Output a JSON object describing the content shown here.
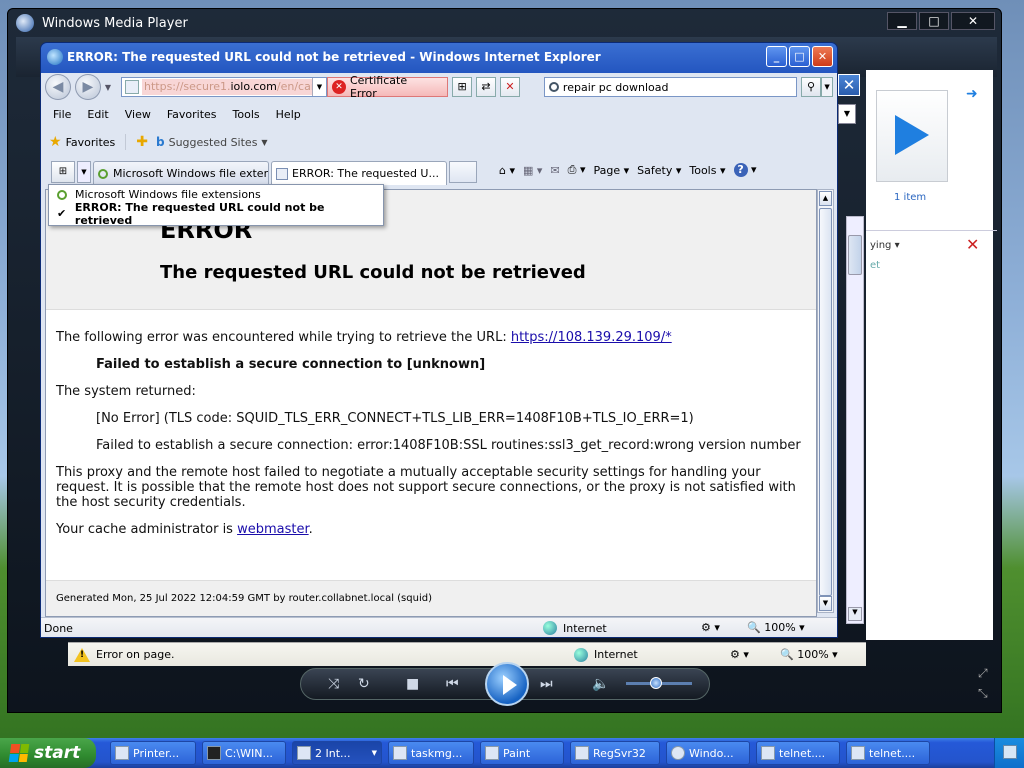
{
  "wmp": {
    "title": "Windows Media Player",
    "min": "▁",
    "max": "□",
    "close": "✕",
    "library_item_count": "1 item",
    "partial_label_1": "ying",
    "partial_label_2": "et",
    "statusbar": {
      "message": "Error on page.",
      "zone": "Internet",
      "zoom": "100%"
    }
  },
  "ie": {
    "title": "ERROR: The requested URL could not be retrieved - Windows Internet Explorer",
    "address_prefix": "https://secure1.",
    "address_domain": "iolo.com",
    "address_suffix": "/en/cart/",
    "cert_error": "Certificate Error",
    "search_value": "repair pc download",
    "menu": [
      "File",
      "Edit",
      "View",
      "Favorites",
      "Tools",
      "Help"
    ],
    "favorites_label": "Favorites",
    "suggested_sites": "Suggested Sites",
    "tabs": [
      {
        "label": "Microsoft Windows file exten..."
      },
      {
        "label": "ERROR: The requested U..."
      }
    ],
    "cmd": {
      "page": "Page",
      "safety": "Safety",
      "tools": "Tools",
      "help": "?"
    },
    "tab_popup": [
      {
        "label": "Microsoft Windows file extensions"
      },
      {
        "label": "ERROR: The requested URL could not be retrieved"
      }
    ],
    "status": {
      "left": "Done",
      "zone": "Internet",
      "zoom": "100%"
    }
  },
  "page": {
    "heading": "ERROR",
    "subheading": "The requested URL could not be retrieved",
    "intro": "The following error was encountered while trying to retrieve the URL: ",
    "intro_link": "https://108.139.29.109/*",
    "failed": "Failed to establish a secure connection to [unknown]",
    "system_returned": "The system returned:",
    "no_error": "[No Error] (TLS code: SQUID_TLS_ERR_CONNECT+TLS_LIB_ERR=1408F10B+TLS_IO_ERR=1)",
    "ssl_error": "Failed to establish a secure connection: error:1408F10B:SSL routines:ssl3_get_record:wrong version number",
    "explanation": "This proxy and the remote host failed to negotiate a mutually acceptable security settings for handling your request. It is possible that the remote host does not support secure connections, or the proxy is not satisfied with the host security credentials.",
    "admin_prefix": "Your cache administrator is ",
    "admin_link": "webmaster",
    "admin_suffix": ".",
    "footer": "Generated Mon, 25 Jul 2022 12:04:59 GMT by router.collabnet.local (squid)"
  },
  "taskbar": {
    "start": "start",
    "tasks": [
      {
        "label": "Printer..."
      },
      {
        "label": "C:\\WIN..."
      },
      {
        "label": "2 Int..."
      },
      {
        "label": "taskmg..."
      },
      {
        "label": "Paint"
      },
      {
        "label": "RegSvr32"
      },
      {
        "label": "Windo..."
      },
      {
        "label": "telnet...."
      },
      {
        "label": "telnet...."
      }
    ]
  }
}
